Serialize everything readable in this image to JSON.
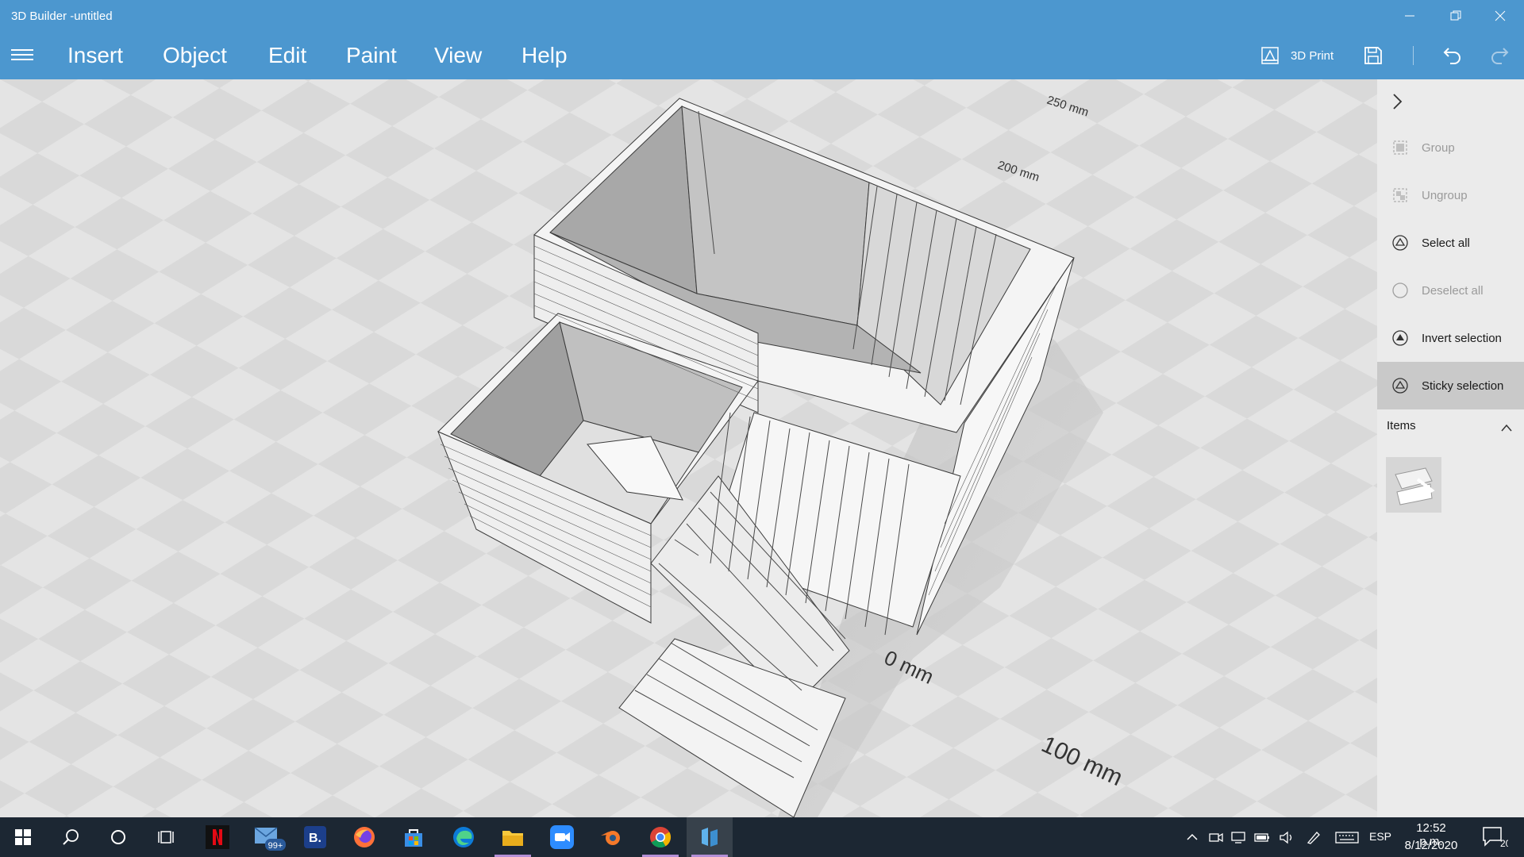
{
  "window": {
    "title": "3D Builder -untitled"
  },
  "menu": {
    "items": [
      "Insert",
      "Object",
      "Edit",
      "Paint",
      "View",
      "Help"
    ],
    "print_label": "3D Print"
  },
  "viewport": {
    "ruler_labels": [
      "250 mm",
      "200 mm",
      "0 mm",
      "100 mm"
    ]
  },
  "panel": {
    "actions": [
      {
        "label": "Group",
        "state": "disabled"
      },
      {
        "label": "Ungroup",
        "state": "disabled"
      },
      {
        "label": "Select all",
        "state": "enabled"
      },
      {
        "label": "Deselect all",
        "state": "disabled"
      },
      {
        "label": "Invert selection",
        "state": "enabled"
      },
      {
        "label": "Sticky selection",
        "state": "active"
      }
    ],
    "items_header": "Items"
  },
  "taskbar": {
    "mail_badge": "99+",
    "language": "ESP",
    "time": "12:52 p.m.",
    "date": "8/12/2020",
    "notification_count": "20"
  },
  "colors": {
    "accent": "#4c97cf",
    "taskbar": "#1c2733",
    "panel": "#ebebeb"
  }
}
